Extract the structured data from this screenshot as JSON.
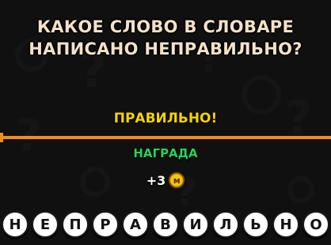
{
  "question": {
    "line1": "КАКОЕ СЛОВО В СЛОВАРЕ",
    "line2": "НАПИСАНО НЕПРАВИЛЬНО?"
  },
  "result": "ПРАВИЛЬНО!",
  "reward": {
    "title": "НАГРАДА",
    "amount": "+3",
    "coin_label": "м"
  },
  "answer_letters": [
    "Н",
    "Е",
    "П",
    "Р",
    "А",
    "В",
    "И",
    "Л",
    "Ь",
    "Н",
    "О"
  ],
  "colors": {
    "question_text": "#f4e1c6",
    "result_text": "#f7d300",
    "divider": "#f48c1c",
    "reward_title": "#24d35b",
    "coin": "#f7c500"
  }
}
